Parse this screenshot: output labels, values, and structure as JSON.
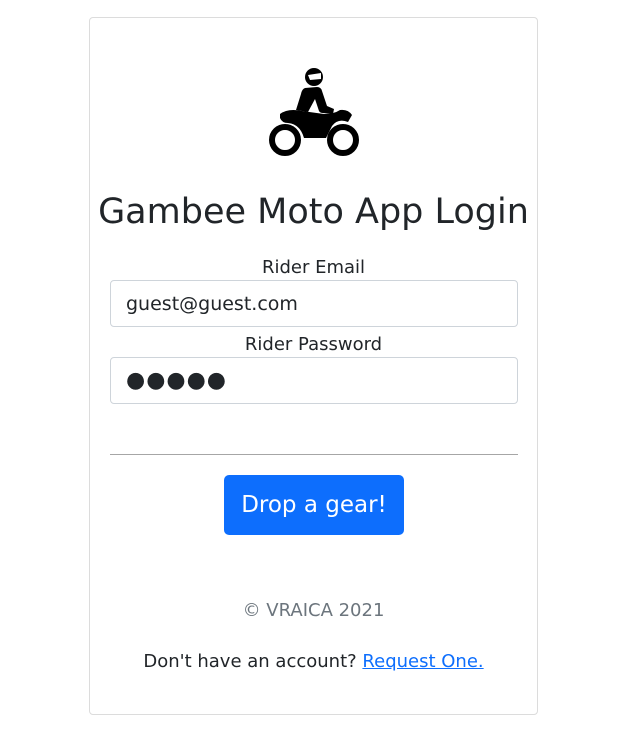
{
  "login": {
    "logo_icon": "motorcycle-rider-icon",
    "title": "Gambee Moto App Login",
    "email_label": "Rider Email",
    "email_value": "guest@guest.com",
    "password_label": "Rider Password",
    "password_masked": "●●●●●",
    "submit_label": "Drop a gear!",
    "copyright": "© VRAICA 2021",
    "no_account_text": "Don't have an account?",
    "request_link": "Request One."
  },
  "colors": {
    "accent": "#0d6efd",
    "muted_text": "#6c757d",
    "text": "#212529"
  }
}
